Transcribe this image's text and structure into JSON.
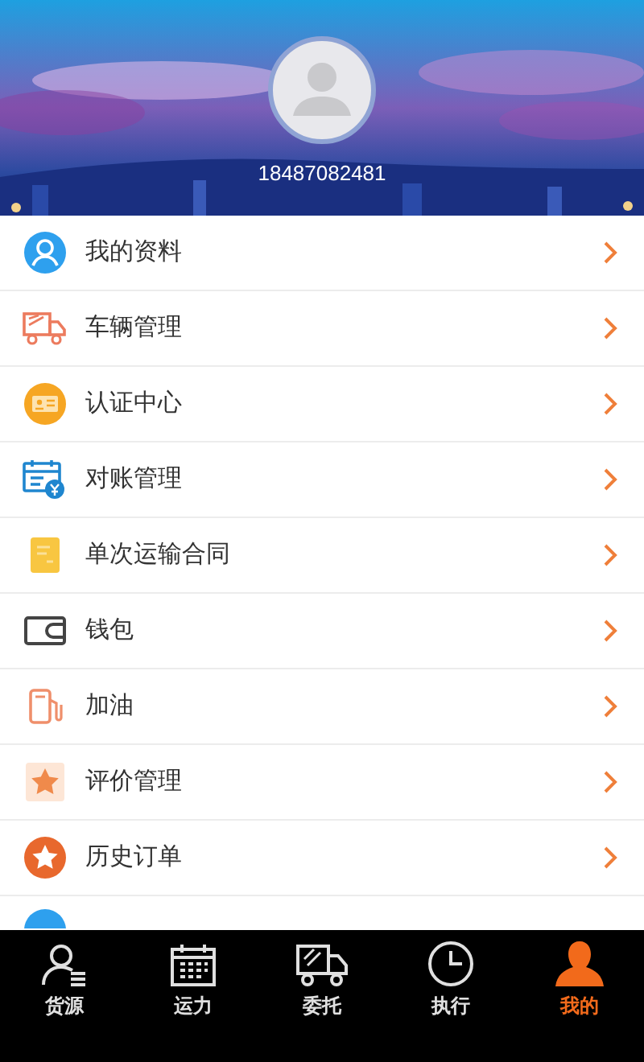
{
  "profile": {
    "phone": "18487082481"
  },
  "menu": [
    {
      "label": "我的资料"
    },
    {
      "label": "车辆管理"
    },
    {
      "label": "认证中心"
    },
    {
      "label": "对账管理"
    },
    {
      "label": "单次运输合同"
    },
    {
      "label": "钱包"
    },
    {
      "label": "加油"
    },
    {
      "label": "评价管理"
    },
    {
      "label": "历史订单"
    }
  ],
  "tabs": [
    {
      "label": "货源",
      "selected": false
    },
    {
      "label": "运力",
      "selected": false
    },
    {
      "label": "委托",
      "selected": false
    },
    {
      "label": "执行",
      "selected": false
    },
    {
      "label": "我的",
      "selected": true
    }
  ]
}
